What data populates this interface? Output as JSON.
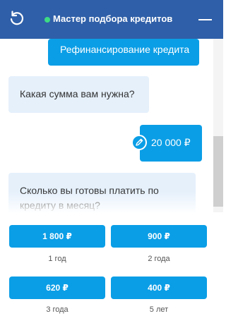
{
  "header": {
    "title": "Мастер подбора кредитов",
    "status_color": "#3ddc84",
    "bg_color": "#2f5fa8",
    "refresh_icon": "refresh-icon",
    "minimize_icon": "minimize-icon"
  },
  "chat": {
    "messages": [
      {
        "from": "user",
        "text": "Рефинансирование кредита"
      },
      {
        "from": "bot",
        "text": "Какая сумма вам нужна?"
      },
      {
        "from": "user",
        "text": "20 000 ₽",
        "edit_icon": "pencil-icon"
      },
      {
        "from": "bot",
        "text": "Сколько вы готовы платить по кредиту в месяц?"
      }
    ]
  },
  "options": [
    {
      "amount": "1 800 ₽",
      "term": "1 год"
    },
    {
      "amount": "900 ₽",
      "term": "2 года"
    },
    {
      "amount": "620 ₽",
      "term": "3 года"
    },
    {
      "amount": "400 ₽",
      "term": "5 лет"
    }
  ],
  "colors": {
    "accent": "#0a9ee6",
    "bot_bubble": "#e5f0fb"
  }
}
